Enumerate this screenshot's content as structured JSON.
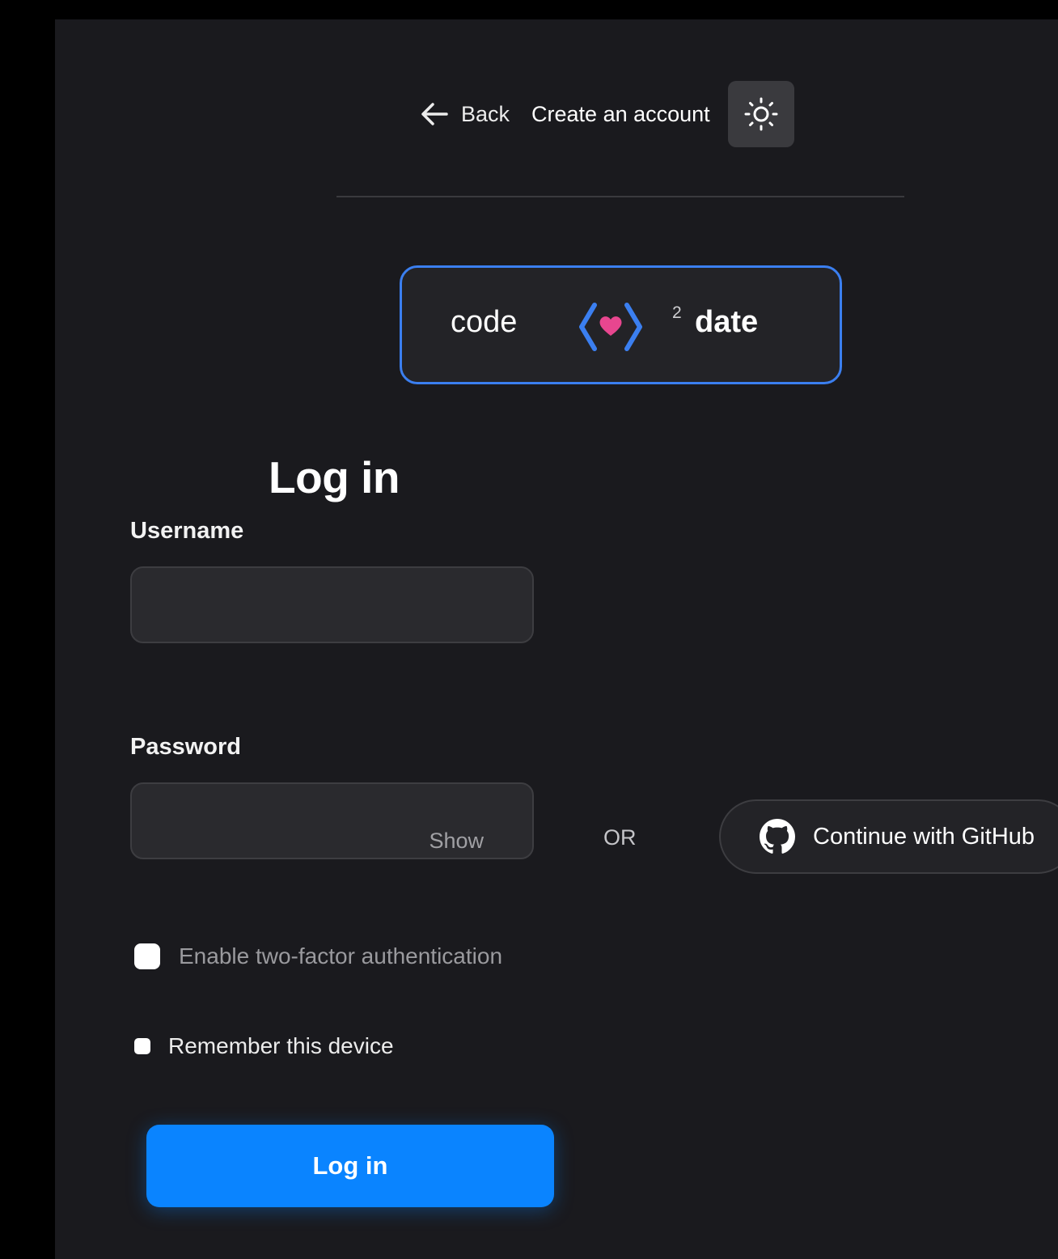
{
  "nav": {
    "back_label": "Back",
    "create_account_label": "Create an account",
    "theme_toggle_icon": "sun-icon"
  },
  "logo": {
    "word_left": "code",
    "superscript": "2",
    "word_right": "date",
    "border_color": "#3b7ff0",
    "heart_color": "#e8468f"
  },
  "form": {
    "title": "Log in",
    "username_label": "Username",
    "username_value": "",
    "password_label": "Password",
    "password_value": "",
    "show_password_label": "Show",
    "two_factor_label": "Enable two-factor authentication",
    "remember_label": "Remember this device",
    "submit_label": "Log in",
    "submit_color": "#0a84ff"
  },
  "alt_auth": {
    "or_label": "OR",
    "github_label": "Continue with GitHub",
    "github_icon": "github-icon"
  }
}
